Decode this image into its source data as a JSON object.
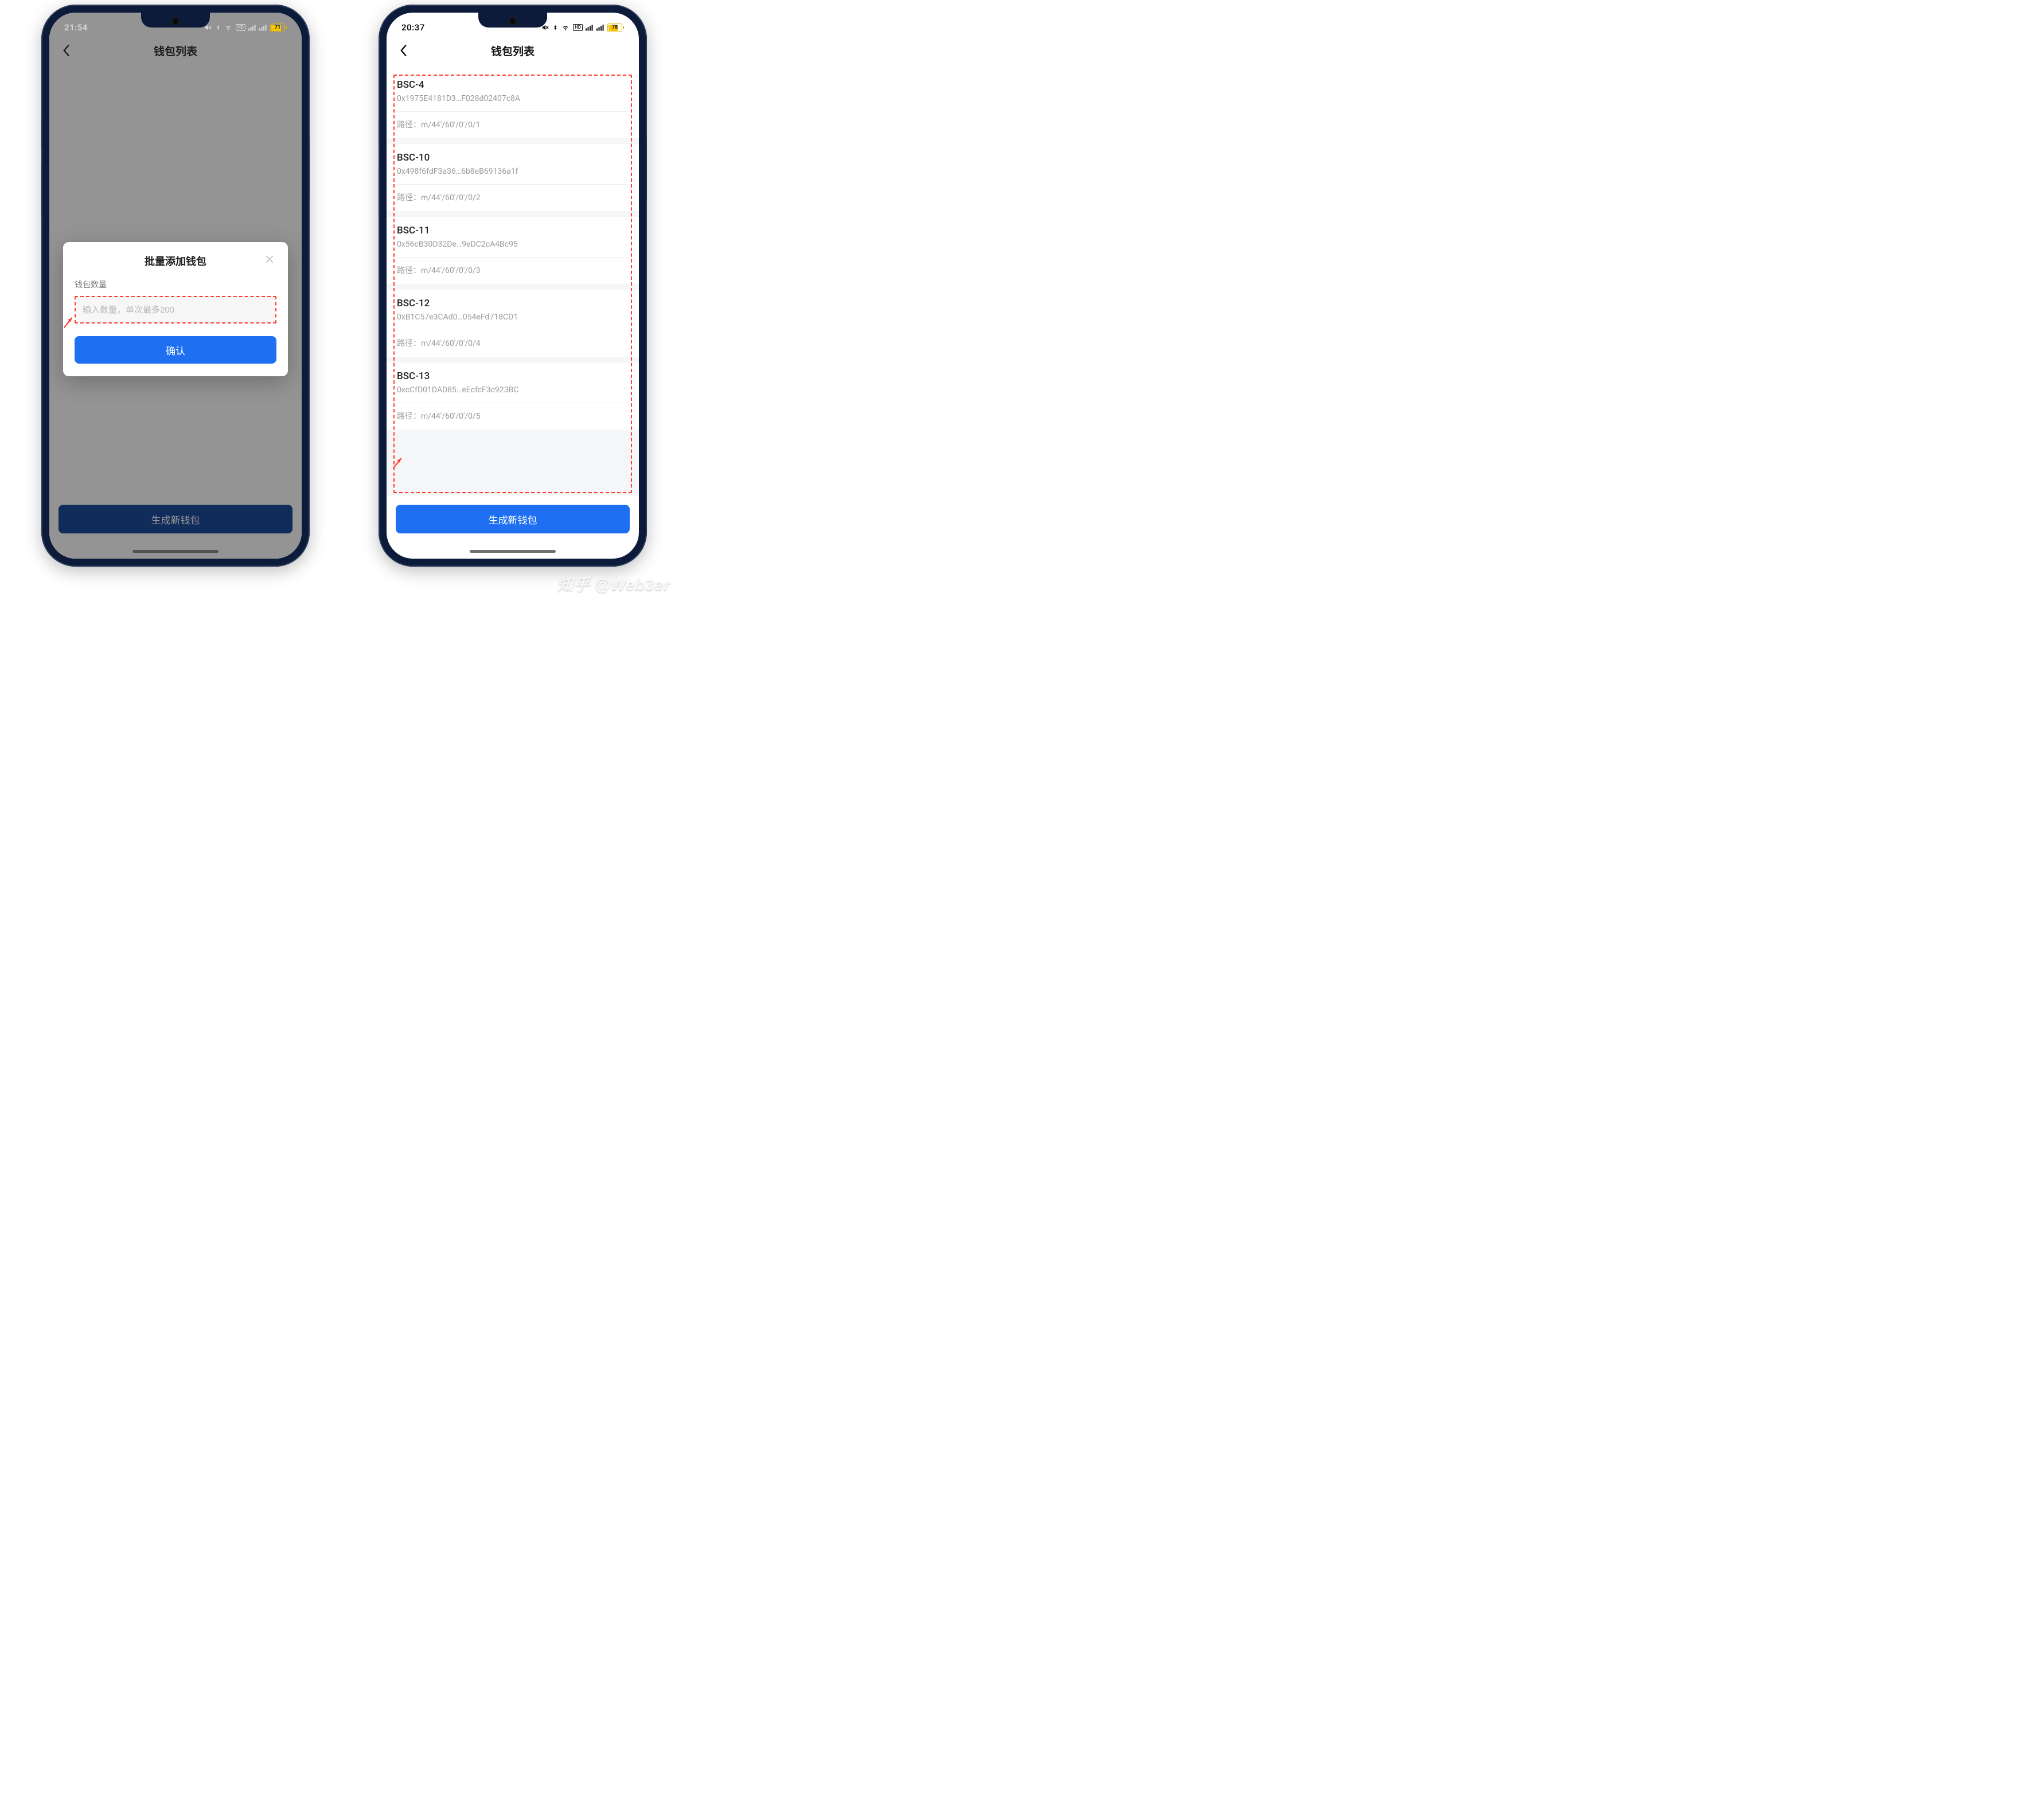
{
  "watermark": "知乎 @Web3er",
  "left": {
    "status": {
      "time": "21:54",
      "battery": "71"
    },
    "header": {
      "title": "钱包列表"
    },
    "bottom_button": "生成新钱包",
    "modal": {
      "title": "批量添加钱包",
      "label": "钱包数量",
      "placeholder": "输入数量，单次最多200",
      "confirm": "确认"
    }
  },
  "right": {
    "status": {
      "time": "20:37",
      "battery": "78"
    },
    "header": {
      "title": "钱包列表"
    },
    "bottom_button": "生成新钱包",
    "path_label": "路径：",
    "wallets": [
      {
        "name": "BSC-4",
        "addr": "0x1975E4181D3…F028d02407c8A",
        "path": "m/44'/60'/0'/0/1"
      },
      {
        "name": "BSC-10",
        "addr": "0x498f6fdF3a36…6b8eB69136a1f",
        "path": "m/44'/60'/0'/0/2"
      },
      {
        "name": "BSC-11",
        "addr": "0x56cB30D32De…9eDC2cA4Bc95",
        "path": "m/44'/60'/0'/0/3"
      },
      {
        "name": "BSC-12",
        "addr": "0xB1C57e3CAd0…054eFd718CD1",
        "path": "m/44'/60'/0'/0/4"
      },
      {
        "name": "BSC-13",
        "addr": "0xcCfD01DAD85…eEcfcF3c923BC",
        "path": "m/44'/60'/0'/0/5"
      }
    ]
  }
}
